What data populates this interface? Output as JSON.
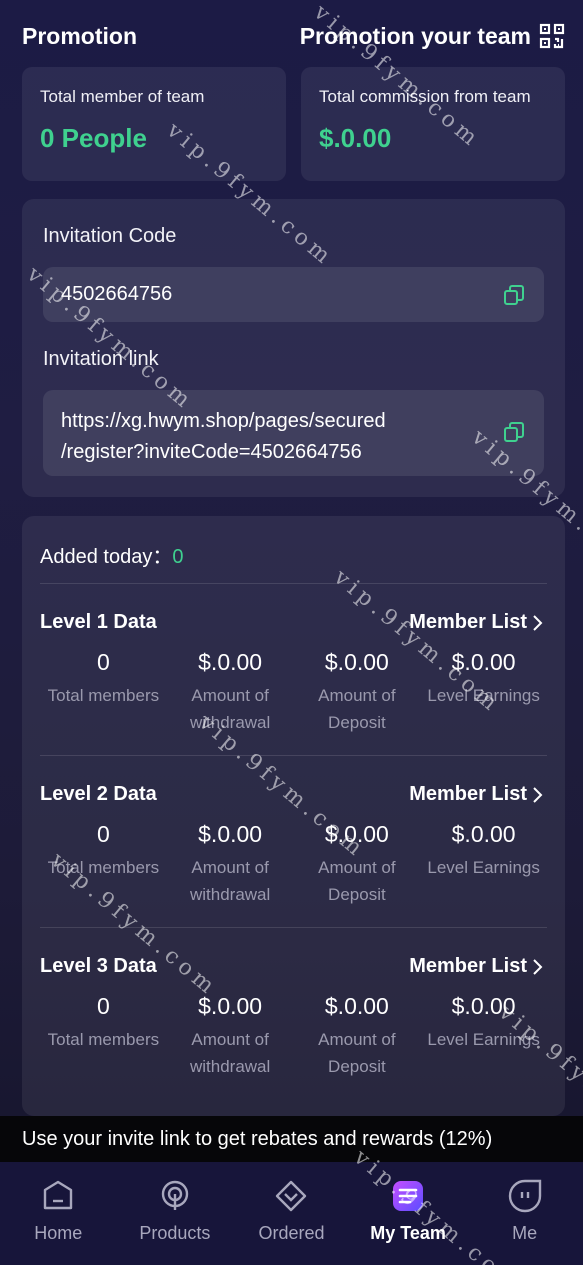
{
  "header": {
    "title": "Promotion",
    "promo_label": "Promotion your team"
  },
  "stats": {
    "members_label": "Total member of team",
    "members_value": "0 People",
    "commission_label": "Total commission from team",
    "commission_value": "$.0.00"
  },
  "invite": {
    "code_label": "Invitation Code",
    "code_value": "4502664756",
    "link_label": "Invitation link",
    "link_line1": "https://xg.hwym.shop/pages/secured",
    "link_line2": "/register?inviteCode=4502664756"
  },
  "team": {
    "added_label": "Added today：",
    "added_value": "0",
    "member_list_label": "Member List",
    "levels": [
      {
        "title": "Level 1 Data",
        "metrics": [
          {
            "value": "0",
            "label1": "Total members",
            "label2": ""
          },
          {
            "value": "$.0.00",
            "label1": "Amount of",
            "label2": "withdrawal"
          },
          {
            "value": "$.0.00",
            "label1": "Amount of",
            "label2": "Deposit"
          },
          {
            "value": "$.0.00",
            "label1": "Level Earnings",
            "label2": ""
          }
        ]
      },
      {
        "title": "Level 2 Data",
        "metrics": [
          {
            "value": "0",
            "label1": "Total members",
            "label2": ""
          },
          {
            "value": "$.0.00",
            "label1": "Amount of",
            "label2": "withdrawal"
          },
          {
            "value": "$.0.00",
            "label1": "Amount of",
            "label2": "Deposit"
          },
          {
            "value": "$.0.00",
            "label1": "Level Earnings",
            "label2": ""
          }
        ]
      },
      {
        "title": "Level 3 Data",
        "metrics": [
          {
            "value": "0",
            "label1": "Total members",
            "label2": ""
          },
          {
            "value": "$.0.00",
            "label1": "Amount of",
            "label2": "withdrawal"
          },
          {
            "value": "$.0.00",
            "label1": "Amount of",
            "label2": "Deposit"
          },
          {
            "value": "$.0.00",
            "label1": "Level Earnings",
            "label2": ""
          }
        ]
      }
    ]
  },
  "rebate_text": "Use your invite link to get rebates and rewards (12%)",
  "tabs": [
    {
      "label": "Home",
      "icon": "home-icon"
    },
    {
      "label": "Products",
      "icon": "products-icon"
    },
    {
      "label": "Ordered",
      "icon": "ordered-icon"
    },
    {
      "label": "My Team",
      "icon": "my-team-icon"
    },
    {
      "label": "Me",
      "icon": "me-icon"
    }
  ],
  "watermark": "vip.9fym.com",
  "colors": {
    "accent_green": "#3fd18f",
    "tab_active": "#9b5cf6",
    "background": "#1c1b45"
  }
}
